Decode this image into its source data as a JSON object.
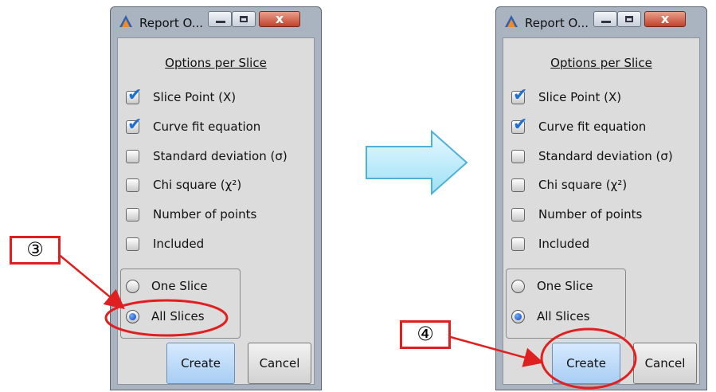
{
  "window_title": "Report O...",
  "title_buttons": {
    "close_glyph": "x"
  },
  "section_title": "Options per Slice",
  "options": [
    {
      "label": "Slice Point (X)"
    },
    {
      "label": "Curve fit equation"
    },
    {
      "label": "Standard deviation (σ)"
    },
    {
      "label": "Chi square (χ²)"
    },
    {
      "label": "Number of points"
    },
    {
      "label": "Included"
    }
  ],
  "checked_state": [
    true,
    true,
    false,
    false,
    false,
    false
  ],
  "radio_options": [
    {
      "label": "One Slice",
      "selected": false
    },
    {
      "label": "All Slices",
      "selected": true
    }
  ],
  "buttons": {
    "create": "Create",
    "cancel": "Cancel"
  },
  "callouts": {
    "step3": "③",
    "step4": "④"
  },
  "colors": {
    "callout_red": "#e02020",
    "arrow_fill": "#c7eefa",
    "arrow_stroke": "#4fb1d6",
    "check_blue": "#1d6fd6"
  },
  "icons": {
    "app": "app-logo-icon",
    "minimize": "minimize-icon",
    "maximize": "maximize-icon",
    "close": "close-icon",
    "checkmark": "checkmark-icon",
    "next_step": "right-arrow-icon"
  }
}
